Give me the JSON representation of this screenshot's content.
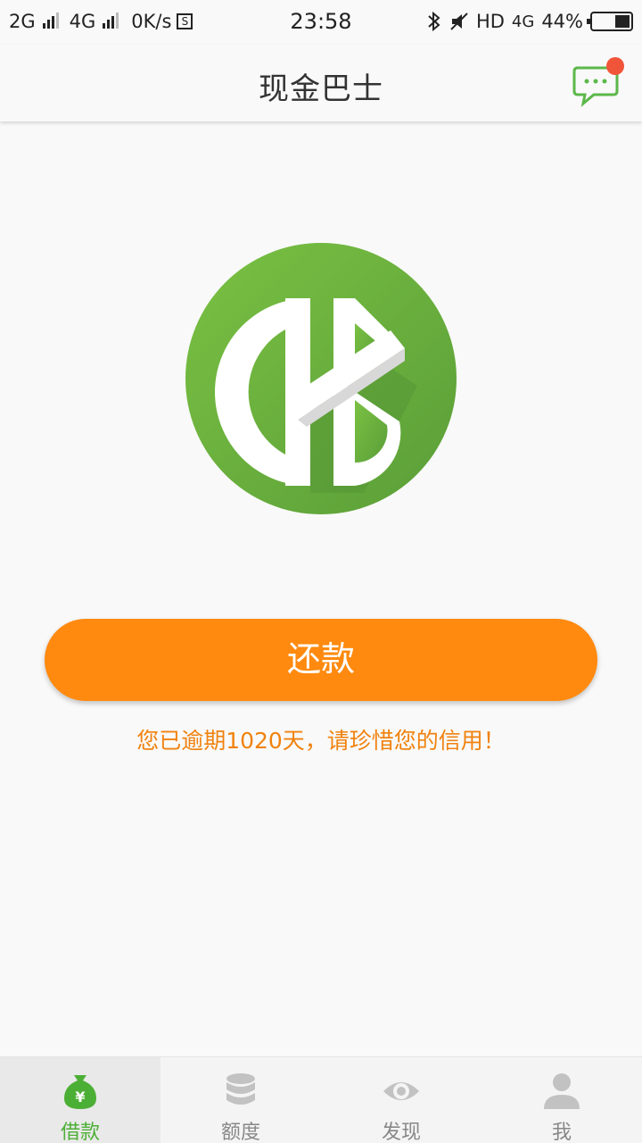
{
  "status_bar": {
    "net1": "2G",
    "net2": "4G",
    "speed": "0K/s",
    "time": "23:58",
    "hd": "HD",
    "lte": "4G",
    "battery": "44%"
  },
  "header": {
    "title": "现金巴士"
  },
  "main": {
    "repay_label": "还款",
    "overdue_message": "您已逾期1020天，请珍惜您的信用！"
  },
  "tabs": [
    {
      "label": "借款",
      "icon": "money-bag-icon",
      "active": true
    },
    {
      "label": "额度",
      "icon": "database-icon",
      "active": false
    },
    {
      "label": "发现",
      "icon": "eye-icon",
      "active": false
    },
    {
      "label": "我",
      "icon": "user-icon",
      "active": false
    }
  ],
  "colors": {
    "brand_green": "#6db33f",
    "accent_orange": "#ff8a0f",
    "warning_text": "#f0820e",
    "notification_dot": "#f0553a"
  }
}
